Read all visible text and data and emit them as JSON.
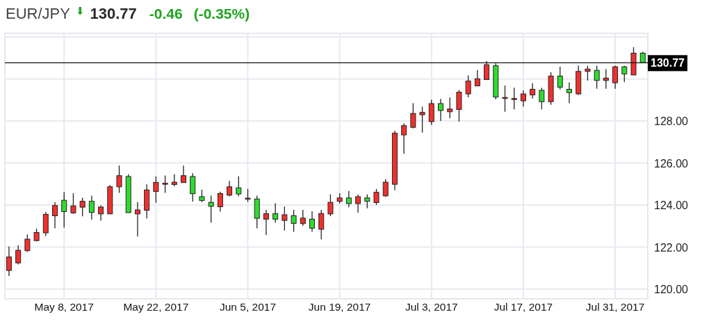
{
  "header": {
    "symbol": "EUR/JPY",
    "arrow": "⬇",
    "price": "130.77",
    "change": "-0.46",
    "change_percent": "(-0.35%)"
  },
  "chart": {
    "chart_data": {
      "type": "candlestick",
      "ylim": [
        119.54,
        132.17
      ],
      "categories": [
        null,
        null,
        null,
        null,
        null,
        null,
        "May 8, 2017",
        null,
        null,
        null,
        null,
        null,
        null,
        null,
        null,
        null,
        "May 22, 2017",
        null,
        null,
        null,
        null,
        null,
        null,
        null,
        null,
        null,
        "Jun 5, 2017",
        null,
        null,
        null,
        null,
        null,
        null,
        null,
        null,
        null,
        "Jun 19, 2017",
        null,
        null,
        null,
        null,
        null,
        null,
        null,
        null,
        null,
        "Jul 3, 2017",
        null,
        null,
        null,
        null,
        null,
        null,
        null,
        null,
        null,
        "Jul 17, 2017",
        null,
        null,
        null,
        null,
        null,
        null,
        null,
        null,
        null,
        "Jul 31, 2017",
        null,
        null,
        null
      ],
      "yticks": [
        {
          "value": 120,
          "label": "120.00"
        },
        {
          "value": 122,
          "label": "122.00"
        },
        {
          "value": 124,
          "label": "124.00"
        },
        {
          "value": 126,
          "label": "126.00"
        },
        {
          "value": 128,
          "label": "128.00"
        }
      ],
      "ohlc": [
        [
          120.89,
          122.03,
          120.63,
          121.53
        ],
        [
          121.25,
          122.08,
          121.18,
          121.85
        ],
        [
          121.83,
          122.6,
          121.77,
          122.38
        ],
        [
          122.31,
          122.88,
          122.27,
          122.7
        ],
        [
          122.68,
          123.67,
          122.52,
          123.56
        ],
        [
          123.49,
          124.14,
          122.9,
          123.98
        ],
        [
          124.23,
          124.62,
          122.93,
          123.69
        ],
        [
          123.63,
          124.57,
          123.58,
          123.96
        ],
        [
          123.9,
          124.35,
          123.47,
          124.18
        ],
        [
          124.18,
          124.45,
          123.31,
          123.65
        ],
        [
          123.58,
          123.98,
          123.26,
          123.91
        ],
        [
          123.58,
          124.95,
          123.58,
          124.87
        ],
        [
          124.87,
          125.88,
          124.58,
          125.4
        ],
        [
          125.36,
          125.47,
          123.64,
          123.64
        ],
        [
          123.58,
          124.14,
          122.51,
          123.77
        ],
        [
          123.75,
          124.99,
          123.37,
          124.72
        ],
        [
          124.65,
          125.36,
          124.11,
          125.08
        ],
        [
          125.04,
          125.41,
          124.58,
          125.04
        ],
        [
          124.98,
          125.47,
          124.9,
          125.09
        ],
        [
          125.07,
          125.88,
          125.07,
          125.4
        ],
        [
          125.36,
          125.52,
          124.17,
          124.54
        ],
        [
          124.4,
          124.73,
          124.14,
          124.22
        ],
        [
          124.13,
          124.45,
          123.16,
          123.94
        ],
        [
          123.92,
          124.64,
          123.69,
          124.55
        ],
        [
          124.47,
          125.15,
          124.42,
          124.87
        ],
        [
          124.82,
          125.37,
          124.42,
          124.53
        ],
        [
          124.33,
          124.77,
          124.15,
          124.33
        ],
        [
          124.29,
          124.45,
          122.9,
          123.37
        ],
        [
          123.33,
          123.77,
          122.58,
          123.59
        ],
        [
          123.59,
          124.09,
          123.16,
          123.33
        ],
        [
          123.27,
          123.93,
          122.79,
          123.54
        ],
        [
          123.5,
          123.77,
          122.73,
          123.13
        ],
        [
          123.12,
          123.77,
          123.01,
          123.38
        ],
        [
          123.33,
          123.71,
          122.73,
          122.9
        ],
        [
          122.85,
          123.77,
          122.37,
          123.6
        ],
        [
          123.58,
          124.51,
          123.47,
          124.13
        ],
        [
          124.18,
          124.56,
          124.07,
          124.34
        ],
        [
          124.34,
          124.67,
          123.9,
          124.07
        ],
        [
          124.07,
          124.51,
          123.64,
          124.4
        ],
        [
          124.34,
          124.51,
          123.85,
          124.18
        ],
        [
          124.12,
          124.77,
          124.01,
          124.61
        ],
        [
          124.44,
          125.23,
          124.39,
          125.09
        ],
        [
          124.99,
          127.53,
          124.71,
          127.42
        ],
        [
          127.34,
          127.89,
          126.44,
          127.78
        ],
        [
          127.7,
          128.85,
          127.65,
          128.36
        ],
        [
          128.3,
          128.68,
          127.45,
          128.41
        ],
        [
          127.97,
          129.01,
          127.81,
          128.83
        ],
        [
          128.83,
          129.05,
          128.0,
          128.5
        ],
        [
          128.44,
          129.12,
          128.13,
          128.57
        ],
        [
          128.55,
          129.48,
          127.97,
          129.37
        ],
        [
          129.29,
          130.17,
          129.13,
          129.9
        ],
        [
          129.67,
          130.43,
          129.67,
          130.01
        ],
        [
          129.97,
          130.85,
          129.97,
          130.68
        ],
        [
          130.63,
          130.74,
          129.03,
          129.14
        ],
        [
          129.12,
          129.69,
          128.44,
          129.12
        ],
        [
          129.07,
          129.58,
          128.55,
          129.07
        ],
        [
          128.96,
          129.46,
          128.69,
          129.29
        ],
        [
          129.24,
          129.8,
          129.07,
          129.51
        ],
        [
          129.46,
          129.58,
          128.55,
          128.92
        ],
        [
          128.92,
          130.32,
          128.77,
          130.14
        ],
        [
          130.14,
          130.58,
          129.5,
          129.61
        ],
        [
          129.51,
          129.84,
          128.85,
          129.35
        ],
        [
          129.29,
          130.63,
          129.24,
          130.36
        ],
        [
          130.36,
          130.63,
          129.92,
          130.47
        ],
        [
          130.41,
          130.63,
          129.53,
          129.93
        ],
        [
          129.93,
          130.47,
          129.53,
          130.04
        ],
        [
          129.82,
          130.63,
          129.53,
          130.58
        ],
        [
          130.58,
          130.63,
          129.85,
          130.24
        ],
        [
          130.19,
          131.51,
          130.19,
          131.23
        ],
        [
          131.23,
          131.29,
          130.77,
          130.77
        ]
      ],
      "ref_lines": [
        {
          "axis": "y",
          "value": 130.77,
          "label": "130.77"
        }
      ],
      "grid": true
    }
  }
}
